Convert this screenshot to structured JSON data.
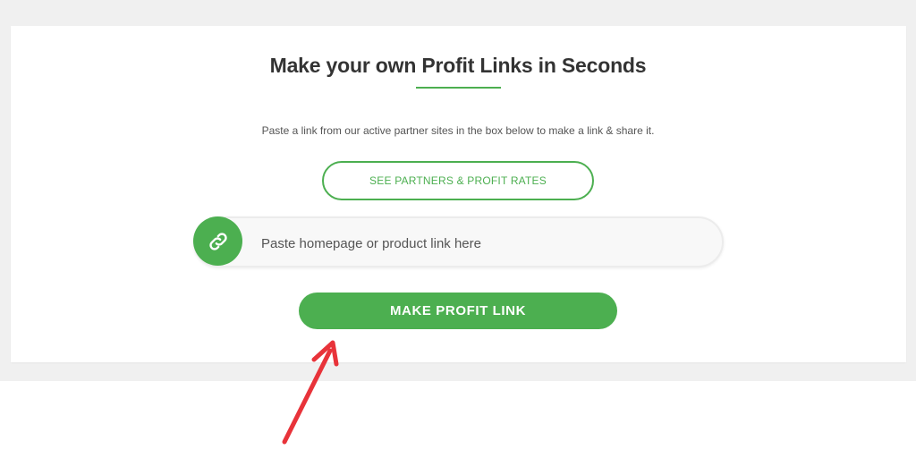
{
  "header": {
    "title": "Make your own Profit Links in Seconds",
    "subtitle": "Paste a link from our active partner sites in the box below to make a link & share it."
  },
  "actions": {
    "partners_label": "SEE PARTNERS & PROFIT RATES",
    "make_label": "MAKE PROFIT LINK"
  },
  "link_input": {
    "placeholder": "Paste homepage or product link here",
    "value": "",
    "icon": "link-icon"
  },
  "colors": {
    "accent": "#4caf50",
    "annotation_arrow": "#e8333a"
  }
}
